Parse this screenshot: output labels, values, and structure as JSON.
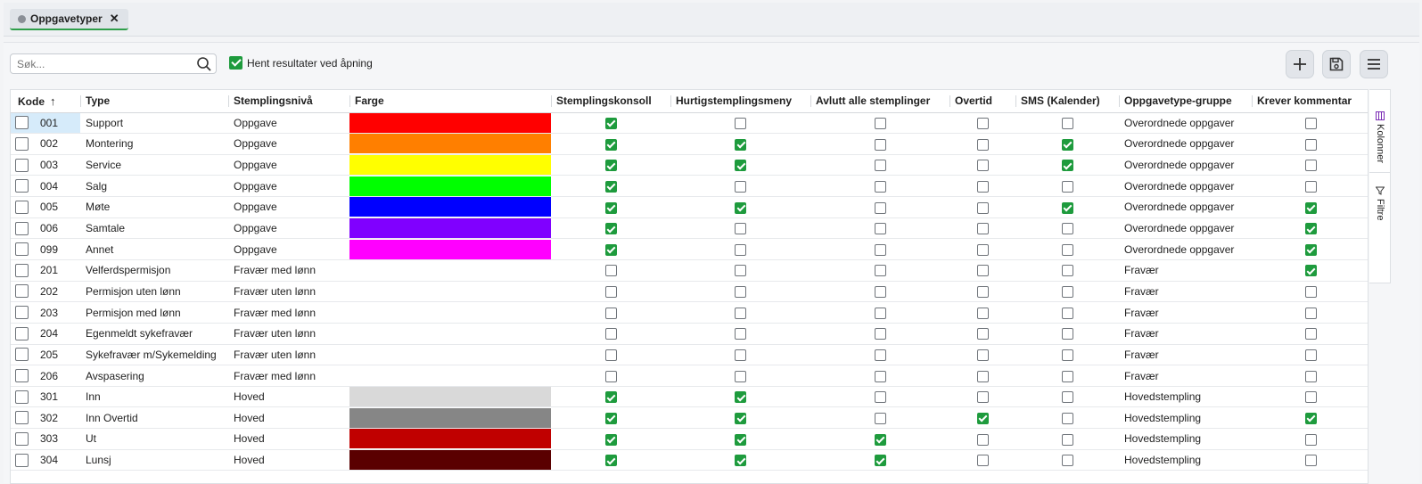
{
  "tab": {
    "label": "Oppgavetyper",
    "close": "✕"
  },
  "toolbar": {
    "search_placeholder": "Søk...",
    "load_on_open_label": "Hent resultater ved åpning",
    "load_on_open_checked": true
  },
  "columns": [
    "Kode",
    "Type",
    "Stemplingsnivå",
    "Farge",
    "Stemplingskonsoll",
    "Hurtigstemplingsmeny",
    "Avlutt alle stemplinger",
    "Overtid",
    "SMS (Kalender)",
    "Oppgavetype-gruppe",
    "Krever kommentar"
  ],
  "sort_indicator": "↑",
  "side_panel": {
    "columns_label": "Kolonner",
    "filters_label": "Filtre"
  },
  "rows": [
    {
      "kode": "001",
      "type": "Support",
      "niva": "Oppgave",
      "farge": "#ff0000",
      "konsoll": true,
      "hurtig": false,
      "avslutt": false,
      "overtid": false,
      "sms": false,
      "gruppe": "Overordnede oppgaver",
      "kommentar": false
    },
    {
      "kode": "002",
      "type": "Montering",
      "niva": "Oppgave",
      "farge": "#ff7f00",
      "konsoll": true,
      "hurtig": true,
      "avslutt": false,
      "overtid": false,
      "sms": true,
      "gruppe": "Overordnede oppgaver",
      "kommentar": false
    },
    {
      "kode": "003",
      "type": "Service",
      "niva": "Oppgave",
      "farge": "#ffff00",
      "konsoll": true,
      "hurtig": true,
      "avslutt": false,
      "overtid": false,
      "sms": true,
      "gruppe": "Overordnede oppgaver",
      "kommentar": false
    },
    {
      "kode": "004",
      "type": "Salg",
      "niva": "Oppgave",
      "farge": "#00ff00",
      "konsoll": true,
      "hurtig": false,
      "avslutt": false,
      "overtid": false,
      "sms": false,
      "gruppe": "Overordnede oppgaver",
      "kommentar": false
    },
    {
      "kode": "005",
      "type": "Møte",
      "niva": "Oppgave",
      "farge": "#0000ff",
      "konsoll": true,
      "hurtig": true,
      "avslutt": false,
      "overtid": false,
      "sms": true,
      "gruppe": "Overordnede oppgaver",
      "kommentar": true
    },
    {
      "kode": "006",
      "type": "Samtale",
      "niva": "Oppgave",
      "farge": "#8000ff",
      "konsoll": true,
      "hurtig": false,
      "avslutt": false,
      "overtid": false,
      "sms": false,
      "gruppe": "Overordnede oppgaver",
      "kommentar": true
    },
    {
      "kode": "099",
      "type": "Annet",
      "niva": "Oppgave",
      "farge": "#ff00ff",
      "konsoll": true,
      "hurtig": false,
      "avslutt": false,
      "overtid": false,
      "sms": false,
      "gruppe": "Overordnede oppgaver",
      "kommentar": true
    },
    {
      "kode": "201",
      "type": "Velferdspermisjon",
      "niva": "Fravær med lønn",
      "farge": "",
      "konsoll": false,
      "hurtig": false,
      "avslutt": false,
      "overtid": false,
      "sms": false,
      "gruppe": "Fravær",
      "kommentar": true
    },
    {
      "kode": "202",
      "type": "Permisjon uten lønn",
      "niva": "Fravær uten lønn",
      "farge": "",
      "konsoll": false,
      "hurtig": false,
      "avslutt": false,
      "overtid": false,
      "sms": false,
      "gruppe": "Fravær",
      "kommentar": false
    },
    {
      "kode": "203",
      "type": "Permisjon med lønn",
      "niva": "Fravær med lønn",
      "farge": "",
      "konsoll": false,
      "hurtig": false,
      "avslutt": false,
      "overtid": false,
      "sms": false,
      "gruppe": "Fravær",
      "kommentar": false
    },
    {
      "kode": "204",
      "type": "Egenmeldt sykefravær",
      "niva": "Fravær uten lønn",
      "farge": "",
      "konsoll": false,
      "hurtig": false,
      "avslutt": false,
      "overtid": false,
      "sms": false,
      "gruppe": "Fravær",
      "kommentar": false
    },
    {
      "kode": "205",
      "type": "Sykefravær m/Sykemelding",
      "niva": "Fravær uten lønn",
      "farge": "",
      "konsoll": false,
      "hurtig": false,
      "avslutt": false,
      "overtid": false,
      "sms": false,
      "gruppe": "Fravær",
      "kommentar": false
    },
    {
      "kode": "206",
      "type": "Avspasering",
      "niva": "Fravær med lønn",
      "farge": "",
      "konsoll": false,
      "hurtig": false,
      "avslutt": false,
      "overtid": false,
      "sms": false,
      "gruppe": "Fravær",
      "kommentar": false
    },
    {
      "kode": "301",
      "type": "Inn",
      "niva": "Hoved",
      "farge": "#d9d9d9",
      "konsoll": true,
      "hurtig": true,
      "avslutt": false,
      "overtid": false,
      "sms": false,
      "gruppe": "Hovedstempling",
      "kommentar": false
    },
    {
      "kode": "302",
      "type": "Inn Overtid",
      "niva": "Hoved",
      "farge": "#868686",
      "konsoll": true,
      "hurtig": true,
      "avslutt": false,
      "overtid": true,
      "sms": false,
      "gruppe": "Hovedstempling",
      "kommentar": true
    },
    {
      "kode": "303",
      "type": "Ut",
      "niva": "Hoved",
      "farge": "#c00000",
      "konsoll": true,
      "hurtig": true,
      "avslutt": true,
      "overtid": false,
      "sms": false,
      "gruppe": "Hovedstempling",
      "kommentar": false
    },
    {
      "kode": "304",
      "type": "Lunsj",
      "niva": "Hoved",
      "farge": "#5a0000",
      "konsoll": true,
      "hurtig": true,
      "avslutt": true,
      "overtid": false,
      "sms": false,
      "gruppe": "Hovedstempling",
      "kommentar": false
    }
  ]
}
